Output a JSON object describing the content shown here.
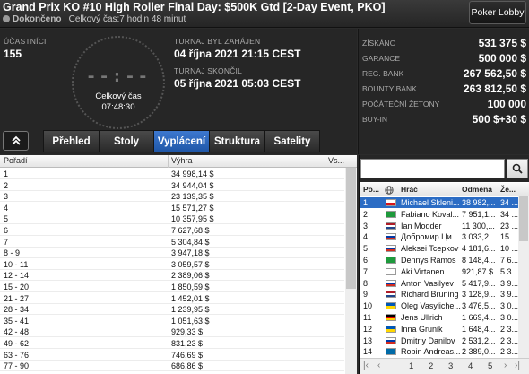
{
  "header": {
    "title": "Grand Prix KO #10 High Roller Final Day: $500K Gtd [2-Day Event, PKO]",
    "status": "Dokončeno",
    "total_time": "| Celkový čas:7 hodin  48 minut",
    "lobby_button": "Poker Lobby"
  },
  "info": {
    "participants_label": "ÚČASTNÍCI",
    "participants_value": "155",
    "clock_digits": "--:--",
    "clock_label": "Celkový čas",
    "clock_time": "07:48:30",
    "started_label": "TURNAJ BYL ZAHÁJEN",
    "started_value": "04 října 2021  21:15 CEST",
    "ended_label": "TURNAJ SKONČIL",
    "ended_value": "05 října 2021  05:03 CEST"
  },
  "stats": [
    {
      "label": "ZÍSKÁNO",
      "value": "531 375 $"
    },
    {
      "label": "GARANCE",
      "value": "500 000 $"
    },
    {
      "label": "REG. BANK",
      "value": "267 562,50 $"
    },
    {
      "label": "BOUNTY BANK",
      "value": "263 812,50 $"
    },
    {
      "label": "POČÁTEČNÍ ŽETONY",
      "value": "100 000"
    },
    {
      "label": "BUY-IN",
      "value": "500 $+30 $"
    }
  ],
  "tabs": [
    {
      "label": "Přehled",
      "active": false
    },
    {
      "label": "Stoly",
      "active": false
    },
    {
      "label": "Vyplácení",
      "active": true
    },
    {
      "label": "Struktura",
      "active": false
    },
    {
      "label": "Satelity",
      "active": false
    }
  ],
  "payout": {
    "headers": {
      "place": "Pořadí",
      "prize": "Výhra",
      "extra": "Vs..."
    },
    "rows": [
      {
        "place": "1",
        "prize": "34 998,14 $"
      },
      {
        "place": "2",
        "prize": "34 944,04 $"
      },
      {
        "place": "3",
        "prize": "23 139,35 $"
      },
      {
        "place": "4",
        "prize": "15 571,27 $"
      },
      {
        "place": "5",
        "prize": "10 357,95 $"
      },
      {
        "place": "6",
        "prize": "7 627,68 $"
      },
      {
        "place": "7",
        "prize": "5 304,84 $"
      },
      {
        "place": "8 - 9",
        "prize": "3 947,18 $"
      },
      {
        "place": "10 - 11",
        "prize": "3 059,57 $"
      },
      {
        "place": "12 - 14",
        "prize": "2 389,06 $"
      },
      {
        "place": "15 - 20",
        "prize": "1 850,59 $"
      },
      {
        "place": "21 - 27",
        "prize": "1 452,01 $"
      },
      {
        "place": "28 - 34",
        "prize": "1 239,95 $"
      },
      {
        "place": "35 - 41",
        "prize": "1 051,63 $"
      },
      {
        "place": "42 - 48",
        "prize": "929,33 $"
      },
      {
        "place": "49 - 62",
        "prize": "831,23 $"
      },
      {
        "place": "63 - 76",
        "prize": "746,69 $"
      },
      {
        "place": "77 - 90",
        "prize": "686,86 $"
      }
    ]
  },
  "players": {
    "search_placeholder": "",
    "headers": {
      "pos": "Po...",
      "name": "Hráč",
      "prize": "Odměna",
      "extra": "Že..."
    },
    "rows": [
      {
        "pos": "1",
        "name": "Michael Skleni...",
        "prize": "38 982,...",
        "extra": "34 ...",
        "selected": true,
        "flag": "cz"
      },
      {
        "pos": "2",
        "name": "Fabiano Koval...",
        "prize": "7 951,1...",
        "extra": "34 ...",
        "flag": "br"
      },
      {
        "pos": "3",
        "name": "Ian Modder",
        "prize": "11 300,...",
        "extra": "23 ...",
        "flag": "nl"
      },
      {
        "pos": "4",
        "name": "Добромир Ци...",
        "prize": "3 033,2...",
        "extra": "15 ...",
        "flag": "ru"
      },
      {
        "pos": "5",
        "name": "Aleksei Tcepkov",
        "prize": "4 181,6...",
        "extra": "10 ...",
        "flag": "ru"
      },
      {
        "pos": "6",
        "name": "Dennys Ramos",
        "prize": "8 148,4...",
        "extra": "7 6...",
        "flag": "br"
      },
      {
        "pos": "7",
        "name": "Aki Virtanen",
        "prize": "921,87 $",
        "extra": "5 3...",
        "flag": "fi"
      },
      {
        "pos": "8",
        "name": "Anton Vasilyev",
        "prize": "5 417,9...",
        "extra": "3 9...",
        "flag": "ru"
      },
      {
        "pos": "9",
        "name": "Richard Bruning",
        "prize": "3 128,9...",
        "extra": "3 9...",
        "flag": "nl"
      },
      {
        "pos": "10",
        "name": "Oleg Vasyliche...",
        "prize": "3 476,5...",
        "extra": "3 0...",
        "flag": "ua"
      },
      {
        "pos": "11",
        "name": "Jens Ullrich",
        "prize": "1 669,4...",
        "extra": "3 0...",
        "flag": "de"
      },
      {
        "pos": "12",
        "name": "Inna Grunik",
        "prize": "1 648,4...",
        "extra": "2 3...",
        "flag": "ua"
      },
      {
        "pos": "13",
        "name": "Dmitriy Danilov",
        "prize": "2 531,2...",
        "extra": "2 3...",
        "flag": "ru"
      },
      {
        "pos": "14",
        "name": "Robin Andreas...",
        "prize": "2 389,0...",
        "extra": "2 3...",
        "flag": "se"
      }
    ],
    "pager": {
      "pages": [
        "1",
        "2",
        "3",
        "4",
        "5"
      ],
      "active": "1"
    }
  },
  "colors": {
    "accent": "#2b6cc4",
    "background": "#262626"
  }
}
